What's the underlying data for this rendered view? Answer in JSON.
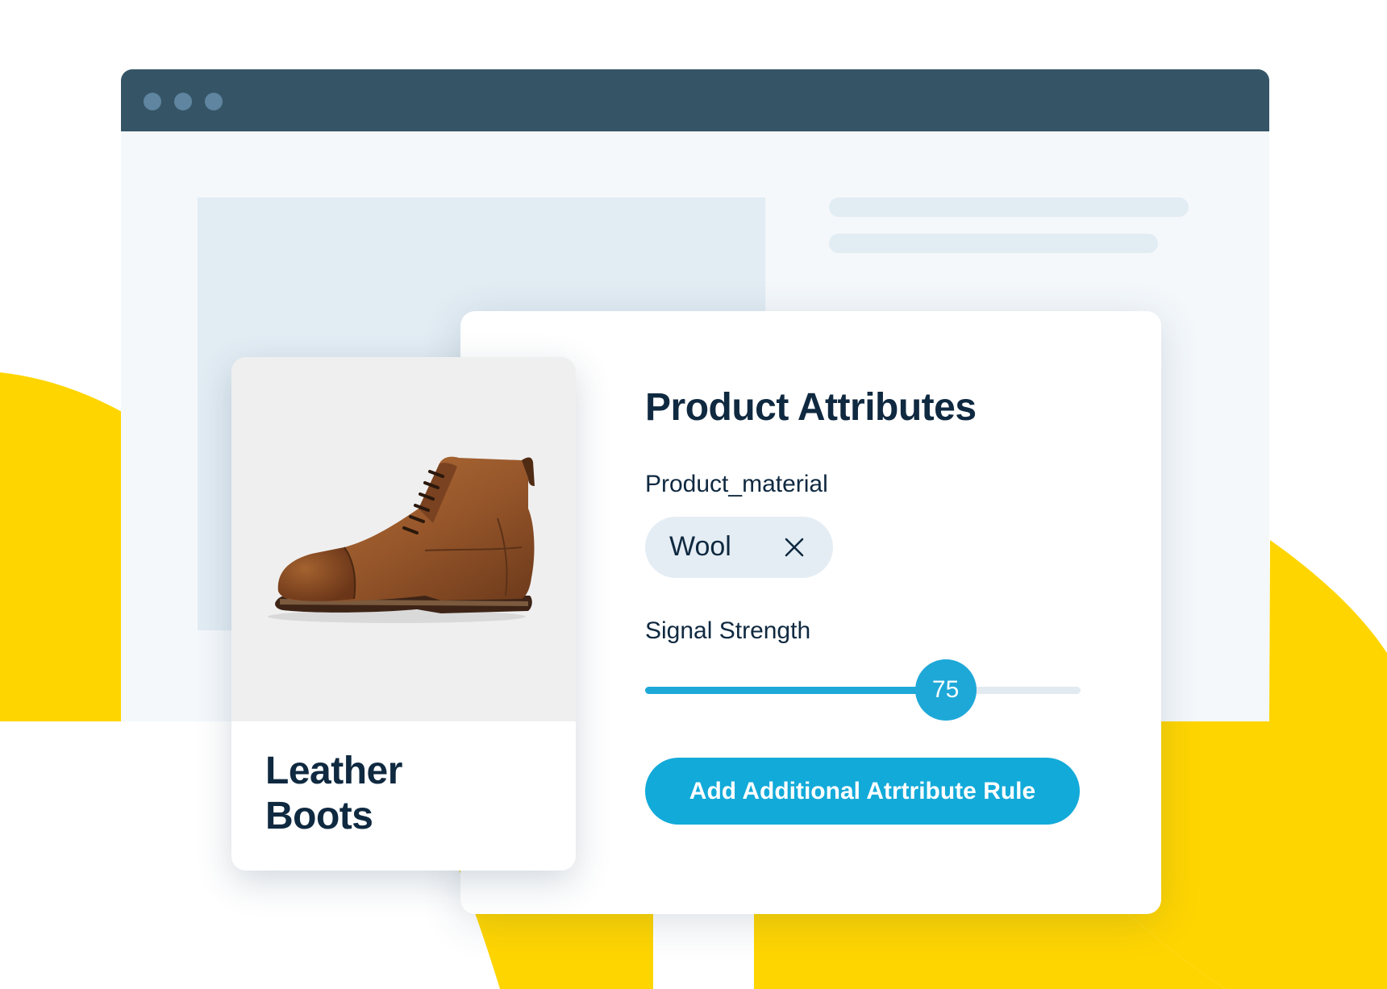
{
  "icons": {
    "window_controls": [
      "window-dot-icon",
      "window-dot-icon",
      "window-dot-icon"
    ],
    "chip_remove": "close-icon",
    "product_photo": "leather-boot-image"
  },
  "colors": {
    "brand_yellow": "#FFD500",
    "window_bar": "#355567",
    "accent_blue": "#12AAD9",
    "heading_text": "#0F2940"
  },
  "product_card": {
    "name": "Leather\nBoots"
  },
  "attributes_panel": {
    "title": "Product Attributes",
    "material_label": "Product_material",
    "material_chip": "Wool",
    "signal_label": "Signal Strength",
    "signal_value": 75,
    "signal_value_text": "75",
    "signal_fill_fraction": 0.69,
    "add_rule_button": "Add Additional Atrtribute Rule"
  }
}
